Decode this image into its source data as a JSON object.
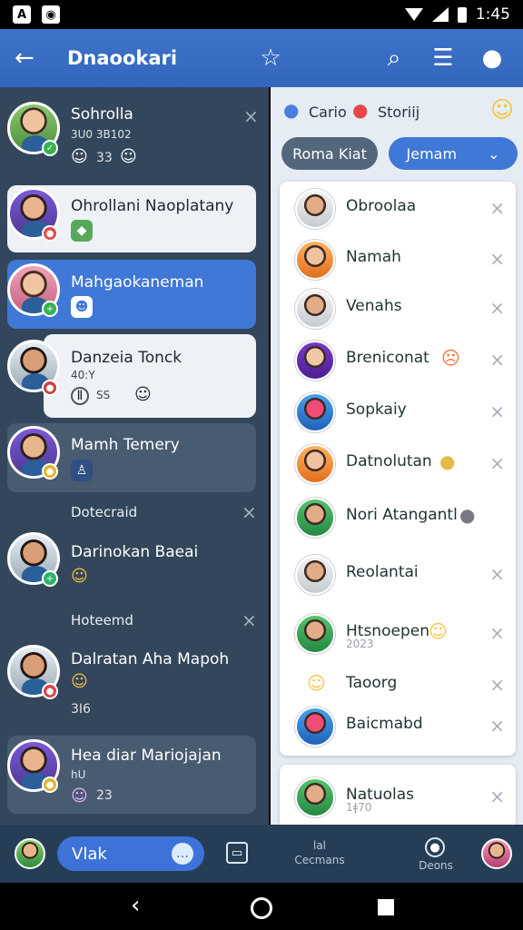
{
  "status": {
    "time": "1:45"
  },
  "appbar": {
    "title": "Dnaookari"
  },
  "left_chats": [
    {
      "name": "Sohrolla",
      "meta": "3U0 3B102",
      "count": "33"
    },
    {
      "name": "Ohrollani Naoplatany"
    },
    {
      "name": "Mahgaokaneman"
    },
    {
      "name": "Danzeia Tonck",
      "meta": "40:Y",
      "count": "SS"
    },
    {
      "name": "Mamh Temery"
    },
    {
      "name": "Darinokan Baeai"
    },
    {
      "name": "Dalratan Aha Mapoh",
      "count": "3I6"
    },
    {
      "name": "Hea diar Mariojajan",
      "meta": "hU",
      "count": "23"
    }
  ],
  "left_dividers": [
    "Dotecraid",
    "Hoteemd"
  ],
  "right": {
    "tabs": [
      {
        "label": "Cario"
      },
      {
        "label": "Storiij"
      }
    ],
    "filters": [
      {
        "label": "Roma Kiat"
      },
      {
        "label": "Jemam"
      }
    ],
    "contacts": [
      {
        "name": "Obroolaa"
      },
      {
        "name": "Namah"
      },
      {
        "name": "Venahs"
      },
      {
        "name": "Breniconat"
      },
      {
        "name": "Sopkaiy"
      },
      {
        "name": "Datnolutan"
      },
      {
        "name": "Nori Atangantl"
      },
      {
        "name": "Reolantai"
      },
      {
        "name": "Htsnoepen",
        "meta": "2023"
      },
      {
        "name": "Taoorg"
      },
      {
        "name": "Baicmabd"
      }
    ],
    "bottom_contact": {
      "name": "Natuolas",
      "meta": "1ǂ70"
    }
  },
  "bottom": {
    "message_placeholder": "Vlak",
    "center_label": "lal",
    "center_sublabel": "Cecmans",
    "right_label": "Deons"
  },
  "icons": {
    "back": "arrow-left-icon",
    "favorite": "star-icon",
    "search": "search-icon",
    "menu": "menu-icon",
    "profile": "user-icon"
  },
  "colors": {
    "appbar": "#3d73c9",
    "left_panel": "#33465b",
    "selected": "#3f78d6"
  }
}
